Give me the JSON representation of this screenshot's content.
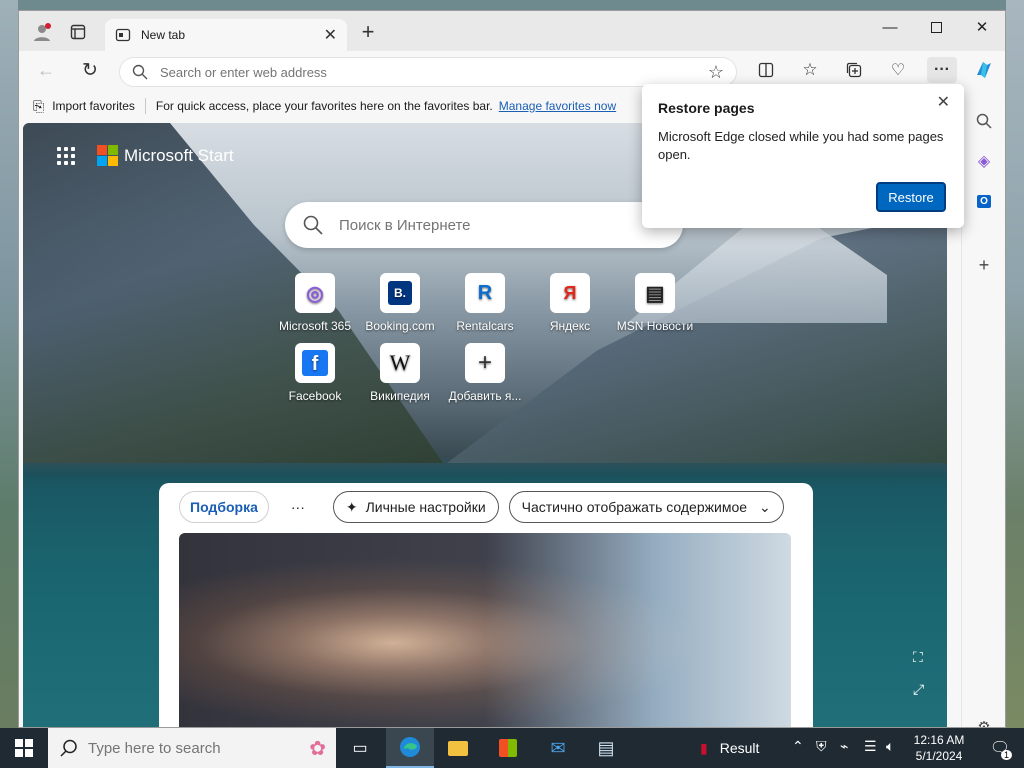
{
  "browser": {
    "tab_title": "New tab",
    "address_placeholder": "Search or enter web address",
    "favorites_bar": {
      "import_label": "Import favorites",
      "message": "For quick access, place your favorites here on the favorites bar.",
      "manage_link": "Manage favorites now"
    }
  },
  "newtab": {
    "brand": "Microsoft Start",
    "search_placeholder": "Поиск в Интернете",
    "tiles": [
      {
        "label": "Microsoft 365",
        "glyph": "◎"
      },
      {
        "label": "Booking.com",
        "glyph": "B."
      },
      {
        "label": "Rentalcars",
        "glyph": "R"
      },
      {
        "label": "Яндекс",
        "glyph": "Я"
      },
      {
        "label": "MSN Новости",
        "glyph": "▤"
      },
      {
        "label": "Facebook",
        "glyph": "f"
      },
      {
        "label": "Википедия",
        "glyph": "W"
      },
      {
        "label": "Добавить я...",
        "glyph": "+"
      }
    ],
    "feed": {
      "tab_active": "Подборка",
      "more": "···",
      "personalize": "Личные настройки",
      "content_mode": "Частично отображать содержимое"
    }
  },
  "popup": {
    "title": "Restore pages",
    "message": "Microsoft Edge closed while you had some pages open.",
    "restore_button": "Restore"
  },
  "taskbar": {
    "search_placeholder": "Type here to search",
    "result_label": "Result",
    "time": "12:16 AM",
    "date": "5/1/2024",
    "notification_count": "1"
  },
  "colors": {
    "accent": "#0067c0",
    "link": "#1a5fb4"
  }
}
